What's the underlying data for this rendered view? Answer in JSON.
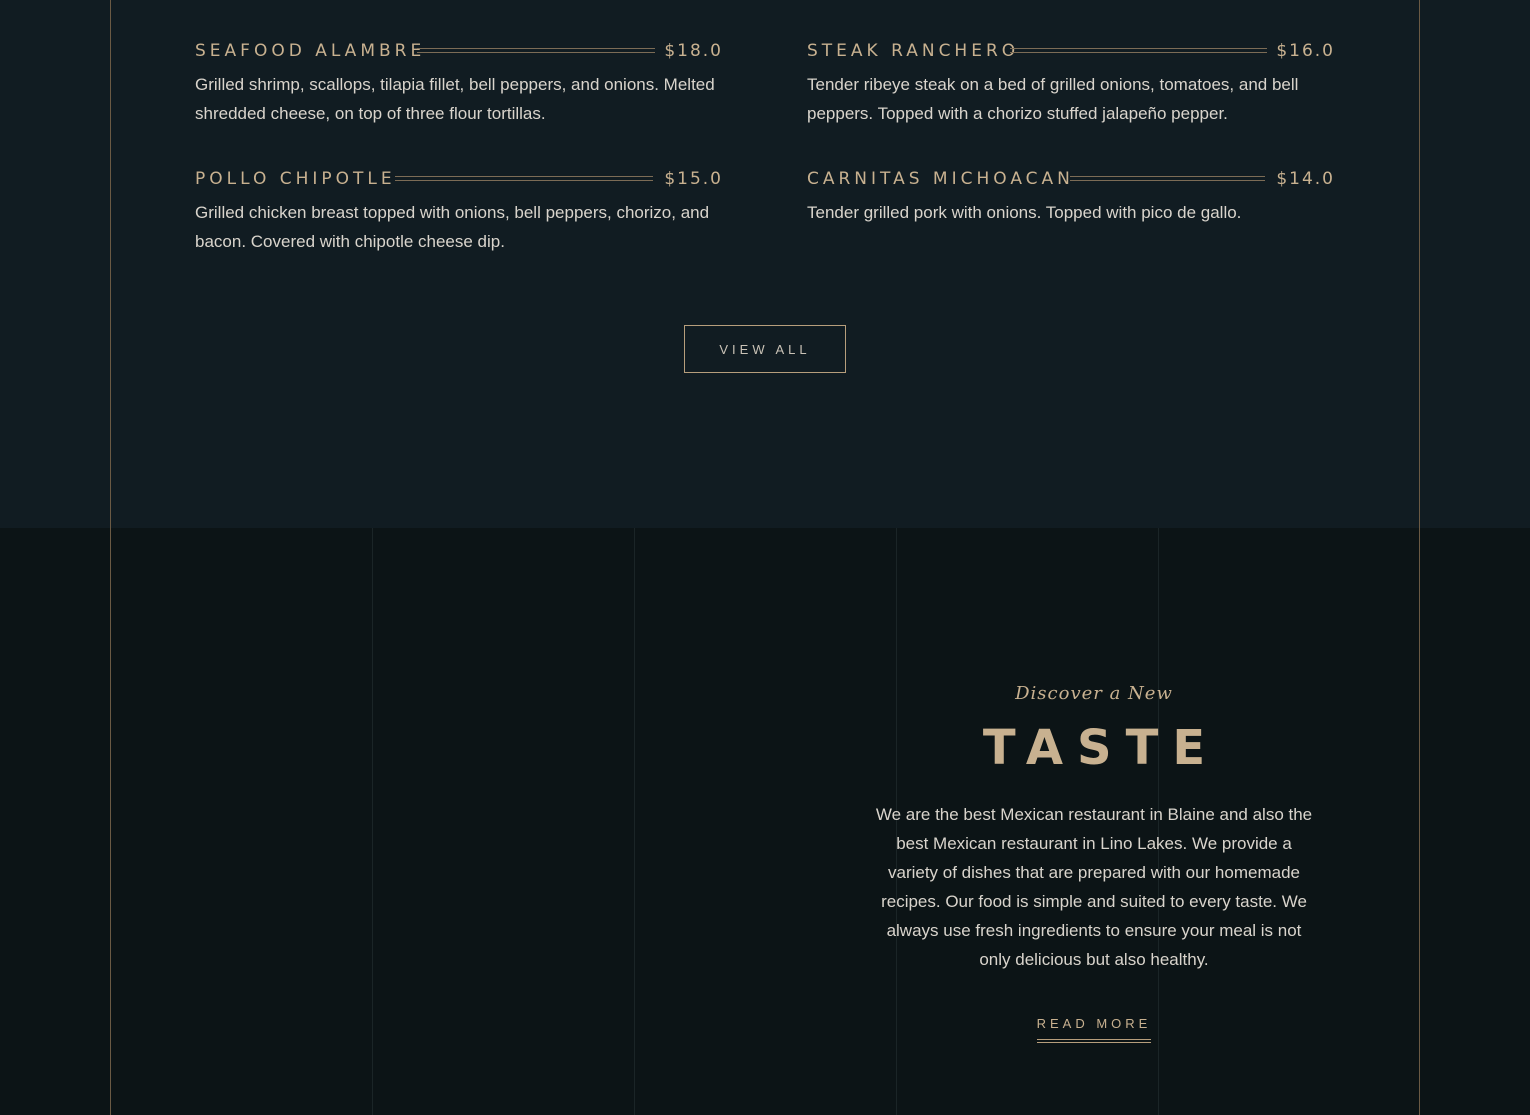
{
  "menu": {
    "items": [
      {
        "name": "Seafood Alambre",
        "price": "$18.0",
        "description": "Grilled shrimp, scallops, tilapia fillet, bell peppers, and onions. Melted shredded cheese, on top of three flour tortillas."
      },
      {
        "name": "Steak Ranchero",
        "price": "$16.0",
        "description": "Tender ribeye steak on a bed of grilled onions, tomatoes, and bell peppers. Topped with a chorizo stuffed jalapeño pepper."
      },
      {
        "name": "Pollo Chipotle",
        "price": "$15.0",
        "description": "Grilled chicken breast topped with onions, bell peppers, chorizo, and bacon. Covered with chipotle cheese dip."
      },
      {
        "name": "Carnitas Michoacan",
        "price": "$14.0",
        "description": "Tender grilled pork with onions. Topped with pico de gallo."
      }
    ],
    "view_all_label": "View All"
  },
  "about": {
    "kicker": "Discover a New",
    "title": "TASTE",
    "text": "We are the best Mexican restaurant in Blaine and also the best Mexican restaurant in Lino Lakes. We provide a variety of dishes that are prepared with our homemade recipes. Our food is simple and suited to every taste. We always use fresh ingredients to ensure your meal is not only delicious but also healthy.",
    "read_more_label": "Read More"
  },
  "colors": {
    "gold": "#c8b190",
    "menu_bg": "#111c22",
    "about_bg": "#0c1416",
    "text": "#d9d4cc"
  }
}
